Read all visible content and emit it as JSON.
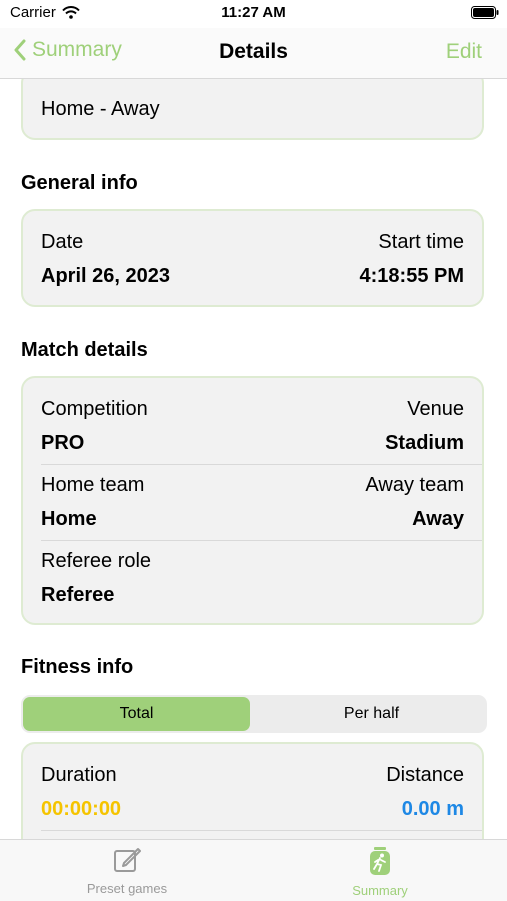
{
  "status_bar": {
    "carrier": "Carrier",
    "time": "11:27 AM"
  },
  "nav": {
    "back_label": "Summary",
    "title": "Details",
    "edit_label": "Edit"
  },
  "teams_card": {
    "text": "Home - Away"
  },
  "general_info": {
    "title": "General info",
    "date_label": "Date",
    "date_value": "April 26, 2023",
    "start_label": "Start time",
    "start_value": "4:18:55 PM"
  },
  "match_details": {
    "title": "Match details",
    "competition_label": "Competition",
    "competition_value": "PRO",
    "venue_label": "Venue",
    "venue_value": "Stadium",
    "home_label": "Home team",
    "home_value": "Home",
    "away_label": "Away team",
    "away_value": "Away",
    "referee_label": "Referee role",
    "referee_value": "Referee"
  },
  "fitness_info": {
    "title": "Fitness info",
    "segments": [
      "Total",
      "Per half"
    ],
    "selected": "Total",
    "duration_label": "Duration",
    "duration_value": "00:00:00",
    "distance_label": "Distance",
    "distance_value": "0.00 m"
  },
  "tabs": [
    {
      "label": "Preset games",
      "icon": "edit-icon"
    },
    {
      "label": "Summary",
      "icon": "runner-icon",
      "active": true
    }
  ],
  "colors": {
    "accent": "#9fd07a",
    "duration": "#f5c400",
    "distance": "#1e88e5"
  }
}
